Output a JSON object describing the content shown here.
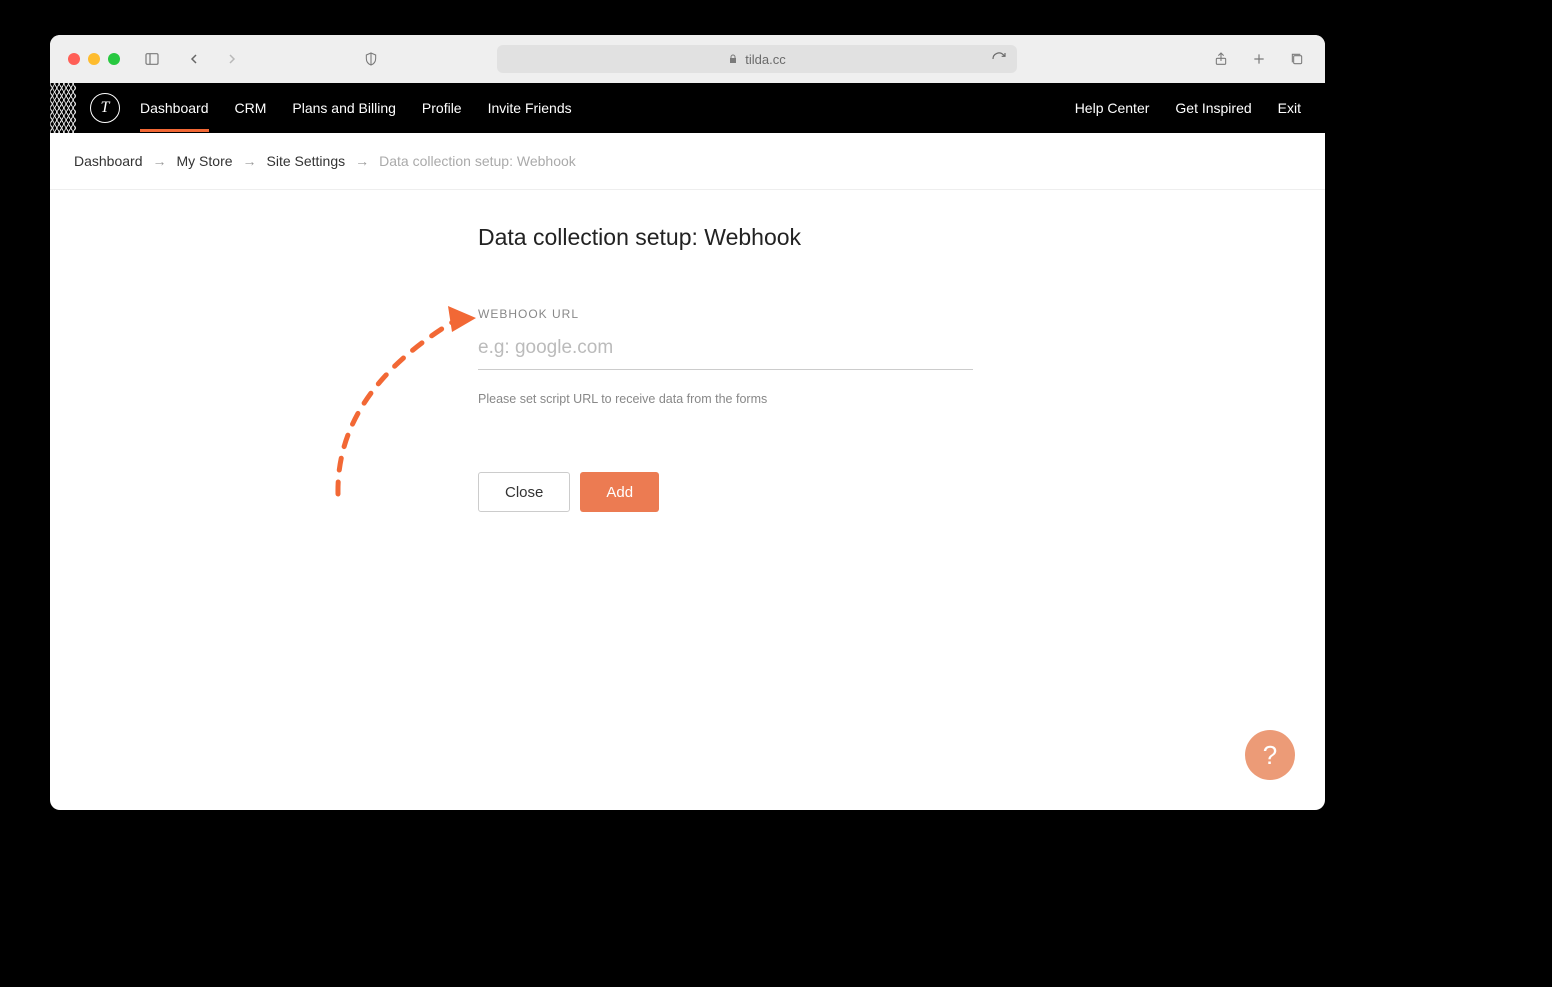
{
  "browser": {
    "url_host": "tilda.cc"
  },
  "header": {
    "logo_letter": "T",
    "nav": [
      {
        "label": "Dashboard",
        "active": true
      },
      {
        "label": "CRM"
      },
      {
        "label": "Plans and Billing"
      },
      {
        "label": "Profile"
      },
      {
        "label": "Invite Friends"
      }
    ],
    "right_nav": [
      {
        "label": "Help Center"
      },
      {
        "label": "Get Inspired"
      },
      {
        "label": "Exit"
      }
    ]
  },
  "breadcrumb": {
    "items": [
      {
        "label": "Dashboard"
      },
      {
        "label": "My Store"
      },
      {
        "label": "Site Settings"
      }
    ],
    "current": "Data collection setup: Webhook",
    "separator": "→"
  },
  "page": {
    "title": "Data collection setup: Webhook",
    "field_label": "WEBHOOK URL",
    "input_placeholder": "e.g: google.com",
    "input_value": "",
    "help_text": "Please set script URL to receive data from the forms",
    "close_label": "Close",
    "add_label": "Add"
  },
  "fab": {
    "symbol": "?"
  },
  "colors": {
    "accent": "#f26835",
    "primary_btn": "#ec7b52",
    "fab": "#ec9b77"
  }
}
